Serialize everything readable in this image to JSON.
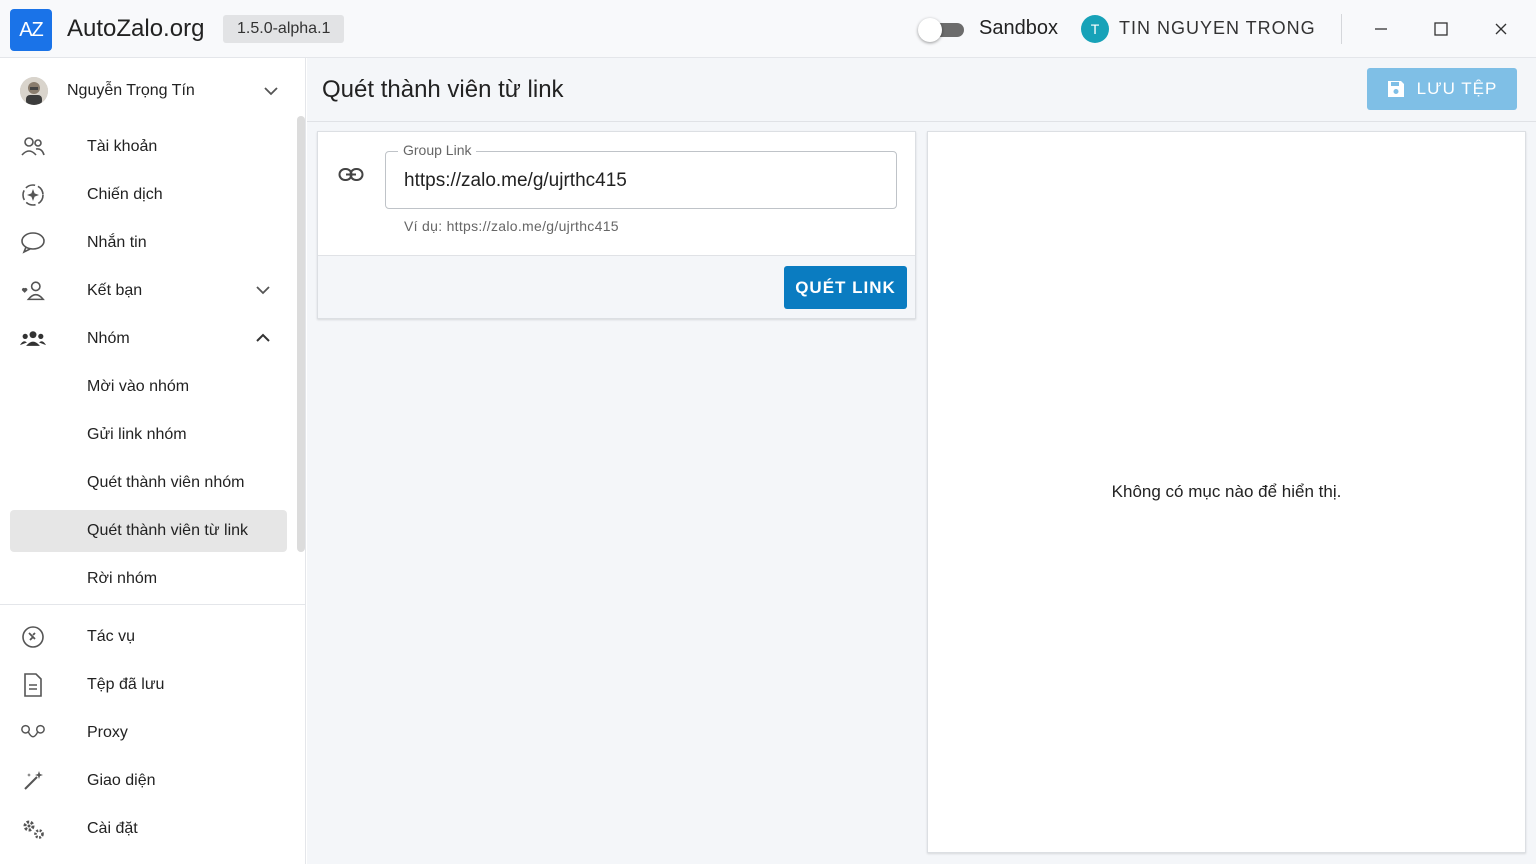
{
  "titlebar": {
    "logo_text": "AZ",
    "app_name": "AutoZalo.org",
    "version": "1.5.0-alpha.1",
    "sandbox_label": "Sandbox",
    "sandbox_enabled": false,
    "user_initial": "T",
    "user_name": "TIN NGUYEN TRONG",
    "minimize_icon": "minimize-icon",
    "maximize_icon": "maximize-icon",
    "close_icon": "close-icon"
  },
  "sidebar": {
    "profile_name": "Nguyễn Trọng Tín",
    "items": [
      {
        "label": "Tài khoản",
        "icon": "accounts-icon"
      },
      {
        "label": "Chiến dịch",
        "icon": "campaign-icon"
      },
      {
        "label": "Nhắn tin",
        "icon": "chat-icon"
      },
      {
        "label": "Kết bạn",
        "icon": "add-friend-icon",
        "expandable": true,
        "expanded": false
      },
      {
        "label": "Nhóm",
        "icon": "group-icon",
        "expandable": true,
        "expanded": true
      },
      {
        "label": "Mời vào nhóm"
      },
      {
        "label": "Gửi link nhóm"
      },
      {
        "label": "Quét thành viên nhóm"
      },
      {
        "label": "Quét thành viên từ link",
        "active": true
      },
      {
        "label": "Rời nhóm"
      },
      {
        "label": "Tác vụ",
        "icon": "tasks-icon"
      },
      {
        "label": "Tệp đã lưu",
        "icon": "file-icon"
      },
      {
        "label": "Proxy",
        "icon": "proxy-icon"
      },
      {
        "label": "Giao diện",
        "icon": "theme-icon"
      },
      {
        "label": "Cài đặt",
        "icon": "settings-icon"
      }
    ]
  },
  "main": {
    "title": "Quét thành viên từ link",
    "save_button": "LƯU TỆP",
    "form": {
      "field_label": "Group Link",
      "field_value": "https://zalo.me/g/ujrthc415",
      "help_text": "Ví dụ: https://zalo.me/g/ujrthc415",
      "scan_button": "QUÉT LINK"
    },
    "empty_message": "Không có mục nào để hiển thị."
  },
  "colors": {
    "accent": "#0a7cc1",
    "accent_light": "#7fbfe6",
    "logo_bg": "#1a73e8",
    "avatar_bg": "#17a2b8"
  }
}
